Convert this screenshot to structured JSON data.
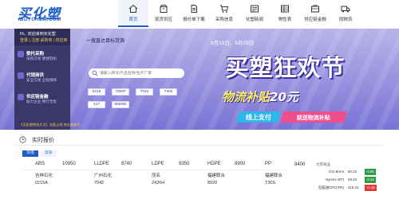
{
  "logo": {
    "main": "买化塑",
    "sub": "IBUYCHEM.COM"
  },
  "nav": [
    {
      "label": "首页",
      "icon": "home-icon",
      "active": true
    },
    {
      "label": "现货供应",
      "icon": "box-icon",
      "active": false
    },
    {
      "label": "报价单下载",
      "icon": "document-icon",
      "active": false
    },
    {
      "label": "采购信息",
      "icon": "cart-icon",
      "active": false
    },
    {
      "label": "化塑新闻",
      "icon": "news-icon",
      "active": false
    },
    {
      "label": "物性表",
      "icon": "table-icon",
      "active": false
    },
    {
      "label": "供应链金融",
      "icon": "finance-icon",
      "active": false
    },
    {
      "label": "找物流",
      "icon": "truck-icon",
      "active": false
    }
  ],
  "sidemenu": {
    "greeting": "Hi，欢迎来到买化塑",
    "links": "登录 | 注册 采购商 | 供应商",
    "groups": [
      {
        "title": "委托采购",
        "sub": "采购交易 便捷轻松"
      },
      {
        "title": "代销商供",
        "sub": "安全交易 全程保障"
      },
      {
        "title": "供应链金融",
        "sub": "助力企业 畅行无忧"
      }
    ],
    "promo": "《买化塑物流大全》全面上线 快去看看吧"
  },
  "search": {
    "title": "一搜直达目标货源",
    "placeholder": "请输入牌号/产品名称/生产厂家",
    "tags": [
      "5218",
      "7000F",
      "7042",
      "T30s",
      "417",
      "M800E"
    ]
  },
  "promo": {
    "date": "8月18日、8月25日",
    "title": "买塑狂欢节",
    "subtitle": "物流补贴",
    "amount": "20元",
    "button1": "线上支付",
    "button2": "就送物流补贴"
  },
  "prices": {
    "title": "实时报价",
    "tabs": [
      "华南",
      "华东"
    ],
    "row1": [
      {
        "name": "ABS",
        "value": "10950"
      },
      {
        "name": "LLDPE",
        "value": "8740"
      },
      {
        "name": "LDPE",
        "value": "9350"
      },
      {
        "name": "HDPE",
        "value": "8900"
      },
      {
        "name": "PP",
        "value": "8400"
      }
    ],
    "row2": [
      {
        "name": "吉林石化",
        "grade": "0215A",
        "value": ""
      },
      {
        "name": "广州石化",
        "grade": "7042",
        "value": ""
      },
      {
        "name": "茂名",
        "grade": "2426H",
        "value": ""
      },
      {
        "name": "福建联合",
        "grade": "8920",
        "value": ""
      },
      {
        "name": "福建联合",
        "grade": "T30S",
        "value": ""
      }
    ]
  },
  "ticker": {
    "header": "大宗商品",
    "items": [
      {
        "name": "ICE Brent",
        "value": "50.22",
        "change": "-0.66",
        "trend": "down"
      },
      {
        "name": "Nymex WTI",
        "value": "48.23",
        "change": "-0.44",
        "trend": "down"
      },
      {
        "name": "石脑油CIF(CFR)",
        "value": "415.23",
        "change": "+1.15",
        "trend": "up"
      }
    ]
  }
}
